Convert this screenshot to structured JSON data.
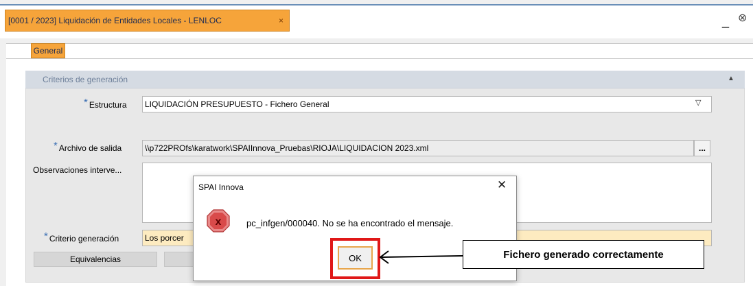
{
  "window": {
    "tab_label": "[0001 / 2023] Liquidación de Entidades Locales - LENLOC",
    "tab_close": "×",
    "minimize": "_",
    "close": "⊗"
  },
  "tabs": {
    "general": "General"
  },
  "group": {
    "title": "Criterios de generación",
    "collapse": "▲"
  },
  "form": {
    "required_mark": "*",
    "estructura_label": "Estructura",
    "estructura_value": "LIQUIDACIÓN PRESUPUESTO - Fichero General",
    "dropdown_arrow": "▽",
    "archivo_label": "Archivo de salida",
    "archivo_value": "\\\\p722PROfs\\karatwork\\SPAIInnova_Pruebas\\RIOJA\\LIQUIDACION 2023.xml",
    "browse": "...",
    "observaciones_label": "Observaciones interve...",
    "observaciones_value": "",
    "criterio_label": "Criterio generación",
    "criterio_value": "Los porcer"
  },
  "buttons": {
    "equivalencias": "Equivalencias"
  },
  "dialog": {
    "title": "SPAI Innova",
    "close": "✕",
    "icon_text": "x",
    "message": "pc_infgen/000040. No se ha encontrado el mensaje.",
    "ok": "OK"
  },
  "annotation": {
    "callout": "Fichero generado correctamente"
  },
  "colors": {
    "accent": "#f6a43a",
    "highlight": "#e01818",
    "required": "#3b6fb3"
  }
}
